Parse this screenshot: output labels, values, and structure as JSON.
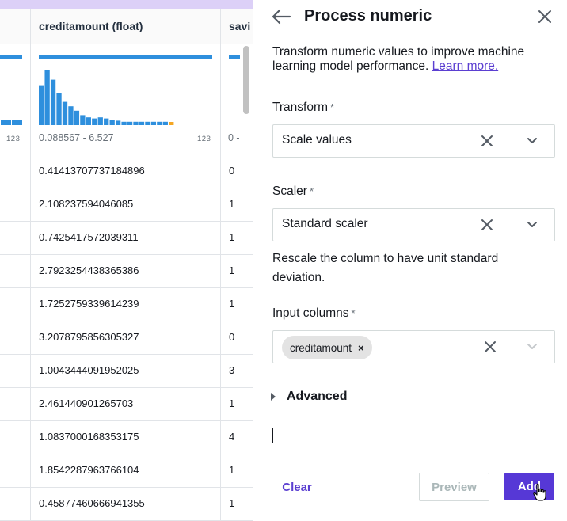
{
  "grid": {
    "columns": [
      {
        "name": "creditamount (float)"
      },
      {
        "name": "savi"
      }
    ],
    "range_label": "0.088567 - 6.527",
    "type_tag": "123",
    "second_col_range": "0 -",
    "histogram_bins": [
      0.72,
      1.0,
      0.82,
      0.58,
      0.42,
      0.34,
      0.26,
      0.18,
      0.14,
      0.12,
      0.14,
      0.12,
      0.1,
      0.08,
      0.06,
      0.06,
      0.06,
      0.06,
      0.06,
      0.06,
      0.06,
      0.06
    ],
    "rows": [
      {
        "creditamount": "0.41413707737184896",
        "savi": "0"
      },
      {
        "creditamount": "2.108237594046085",
        "savi": "1"
      },
      {
        "creditamount": "0.7425417572039311",
        "savi": "1"
      },
      {
        "creditamount": "2.7923254438365386",
        "savi": "1"
      },
      {
        "creditamount": "1.7252759339614239",
        "savi": "1"
      },
      {
        "creditamount": "3.2078795856305327",
        "savi": "0"
      },
      {
        "creditamount": "1.0043444091952025",
        "savi": "3"
      },
      {
        "creditamount": "2.461440901265703",
        "savi": "1"
      },
      {
        "creditamount": "1.0837000168353175",
        "savi": "4"
      },
      {
        "creditamount": "1.8542287963766104",
        "savi": "1"
      },
      {
        "creditamount": "0.45877460666941355",
        "savi": "1"
      }
    ],
    "colors": {
      "bar": "#2e8fdd",
      "last_bar": "#f5a623",
      "header_strip": "#dcd0f7"
    }
  },
  "panel": {
    "title": "Process numeric",
    "back_icon": "arrow-left-icon",
    "close_icon": "close-icon",
    "description": "Transform numeric values to improve machine learning model performance.",
    "learn_more": "Learn more.",
    "transform": {
      "label": "Transform",
      "required": "*",
      "value": "Scale values"
    },
    "scaler": {
      "label": "Scaler",
      "required": "*",
      "value": "Standard scaler"
    },
    "scaler_hint": "Rescale the column to have unit standard deviation.",
    "input_columns": {
      "label": "Input columns",
      "required": "*",
      "chips": [
        "creditamount"
      ],
      "chip_remove": "×"
    },
    "advanced": "Advanced",
    "buttons": {
      "clear": "Clear",
      "preview": "Preview",
      "add": "Add"
    },
    "accent": "#5638d6"
  }
}
